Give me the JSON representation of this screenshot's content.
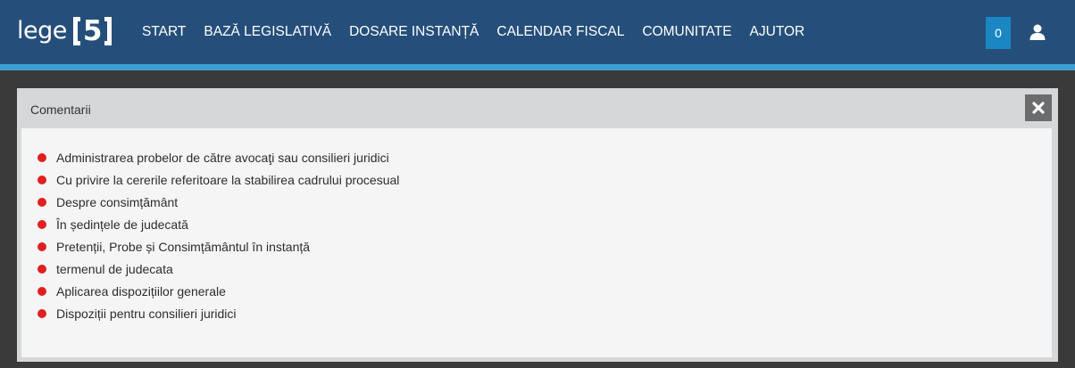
{
  "brand": {
    "word": "lege",
    "number": "5"
  },
  "nav": {
    "items": [
      {
        "label": "START"
      },
      {
        "label": "BAZĂ LEGISLATIVĂ"
      },
      {
        "label": "DOSARE INSTANȚĂ"
      },
      {
        "label": "CALENDAR FISCAL"
      },
      {
        "label": "COMUNITATE"
      },
      {
        "label": "AJUTOR"
      }
    ]
  },
  "header_right": {
    "notification_count": "0",
    "user_icon": "user-icon"
  },
  "modal": {
    "title": "Comentarii",
    "close_icon": "close-icon",
    "items": [
      {
        "label": "Administrarea probelor de către avocaţi sau consilieri juridici"
      },
      {
        "label": "Cu privire la cererile referitoare la stabilirea cadrului procesual"
      },
      {
        "label": "Despre consimțământ"
      },
      {
        "label": "În ședințele de judecată"
      },
      {
        "label": "Pretenții, Probe și Consimțământul în instanță"
      },
      {
        "label": "termenul de judecata"
      },
      {
        "label": "Aplicarea dispozițiilor generale"
      },
      {
        "label": "Dispoziții pentru consilieri juridici"
      }
    ]
  },
  "colors": {
    "header_bg": "#254f7a",
    "header_stripe": "#3d9fd4",
    "page_bg": "#3a3a3a",
    "badge_bg": "#1a87c2",
    "bullet": "#e02020",
    "close_bg": "#6c6c6c"
  }
}
